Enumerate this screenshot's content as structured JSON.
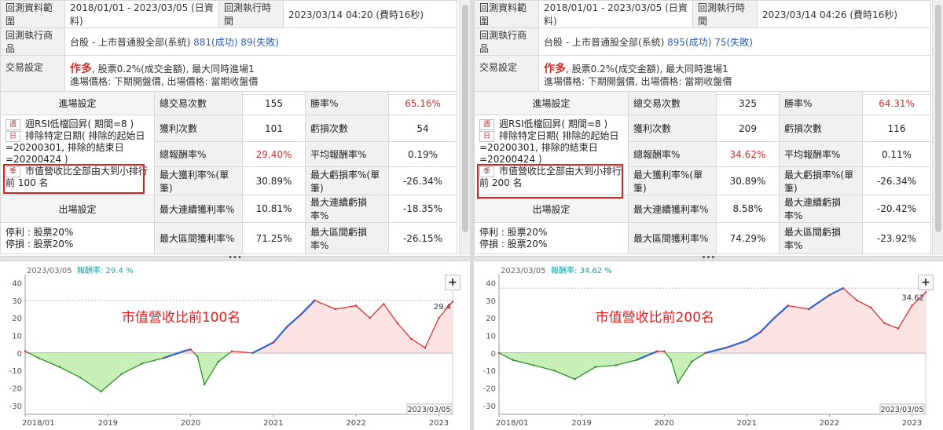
{
  "panels": [
    {
      "header": {
        "range_label": "回測資料範圍",
        "range_value": "2018/01/01 - 2023/03/05 (日資料)",
        "exec_time_label": "回測執行時間",
        "exec_time_value": "2023/03/14 04:20 (費時16秒)",
        "product_label": "回測執行商品",
        "product_value": "台股 - 上市普通股全部(系統)",
        "success": "881(成功)",
        "fail": "89(失敗)",
        "trade_label": "交易設定",
        "trade_mode": "作多",
        "trade_desc": ", 股票0.2%(成交金額), 最大同時進場1",
        "trade_desc2": "進場價格: 下期開盤價, 出場價格: 當期收盤價"
      },
      "entry": {
        "title": "進場設定",
        "tag1": "週",
        "cond1": "週RSI低檔回昇( 期間=8 )",
        "tag2": "日",
        "cond2": "排除特定日期( 排除的起始日=20200301, 排除的結束日=20200424 )",
        "tag3": "季",
        "cond3": "市值營收比全部由大到小排行前 100 名"
      },
      "exit": {
        "title": "出場設定",
        "stop_profit": "停利 : 股票20%",
        "stop_loss": "停損 : 股票20%"
      },
      "stats": [
        {
          "l1": "總交易次數",
          "v1": "155",
          "l2": "勝率%",
          "v2": "65.16%"
        },
        {
          "l1": "獲利次數",
          "v1": "101",
          "l2": "虧損次數",
          "v2": "54"
        },
        {
          "l1": "總報酬率%",
          "v1": "29.40%",
          "l2": "平均報酬率%",
          "v2": "0.19%"
        },
        {
          "l1": "最大獲利率%(單筆)",
          "v1": "30.89%",
          "l2": "最大虧損率%(單筆)",
          "v2": "-26.34%"
        },
        {
          "l1": "最大連續獲利率%",
          "v1": "10.81%",
          "l2": "最大連續虧損率%",
          "v2": "-18.35%"
        },
        {
          "l1": "最大區間獲利率%",
          "v1": "71.25%",
          "l2": "最大區間虧損率%",
          "v2": "-26.15%"
        }
      ],
      "chart": {
        "date_label": "2023/03/05",
        "return_label": "報酬率: 29.4 %",
        "annotation": "市值營收比前100名",
        "last_value": "29.4",
        "end_date_label": "2023/03/05",
        "y_ticks": [
          "40",
          "30",
          "20",
          "10",
          "0",
          "-10",
          "-20",
          "-30"
        ],
        "x_ticks": [
          "2018/01",
          "2019",
          "2020",
          "2021",
          "2022",
          "2023"
        ]
      },
      "chart_data": {
        "type": "area",
        "x": [
          "2018/01",
          "2018/03",
          "2018/06",
          "2018/09",
          "2018/12",
          "2019/03",
          "2019/06",
          "2019/09",
          "2019/12",
          "2020/01",
          "2020/02",
          "2020/03",
          "2020/05",
          "2020/07",
          "2020/10",
          "2021/01",
          "2021/03",
          "2021/05",
          "2021/07",
          "2021/10",
          "2022/01",
          "2022/03",
          "2022/05",
          "2022/07",
          "2022/09",
          "2022/11",
          "2023/01",
          "2023/03"
        ],
        "y": [
          1,
          -3,
          -8,
          -14,
          -22,
          -12,
          -6,
          -3,
          1,
          2,
          -2,
          -18,
          -5,
          1,
          0,
          6,
          15,
          22,
          30,
          25,
          27,
          20,
          28,
          17,
          8,
          3,
          20,
          29.4
        ],
        "ylim": [
          -35,
          42
        ],
        "grid": false
      }
    },
    {
      "header": {
        "range_label": "回測資料範圍",
        "range_value": "2018/01/01 - 2023/03/05 (日資料)",
        "exec_time_label": "回測執行時間",
        "exec_time_value": "2023/03/14 04:26 (費時16秒)",
        "product_label": "回測執行商品",
        "product_value": "台股 - 上市普通股全部(系統)",
        "success": "895(成功)",
        "fail": "75(失敗)",
        "trade_label": "交易設定",
        "trade_mode": "作多",
        "trade_desc": ", 股票0.2%(成交金額), 最大同時進場1",
        "trade_desc2": "進場價格: 下期開盤價, 出場價格: 當期收盤價"
      },
      "entry": {
        "title": "進場設定",
        "tag1": "週",
        "cond1": "週RSI低檔回昇( 期間=8 )",
        "tag2": "日",
        "cond2": "排除特定日期( 排除的起始日=20200301, 排除的結束日=20200424 )",
        "tag3": "季",
        "cond3": "市值營收比全部由大到小排行前 200 名"
      },
      "exit": {
        "title": "出場設定",
        "stop_profit": "停利 : 股票20%",
        "stop_loss": "停損 : 股票20%"
      },
      "stats": [
        {
          "l1": "總交易次數",
          "v1": "325",
          "l2": "勝率%",
          "v2": "64.31%"
        },
        {
          "l1": "獲利次數",
          "v1": "209",
          "l2": "虧損次數",
          "v2": "116"
        },
        {
          "l1": "總報酬率%",
          "v1": "34.62%",
          "l2": "平均報酬率%",
          "v2": "0.11%"
        },
        {
          "l1": "最大獲利率%(單筆)",
          "v1": "30.89%",
          "l2": "最大虧損率%(單筆)",
          "v2": "-26.34%"
        },
        {
          "l1": "最大連續獲利率%",
          "v1": "8.58%",
          "l2": "最大連續虧損率%",
          "v2": "-20.42%"
        },
        {
          "l1": "最大區間獲利率%",
          "v1": "74.29%",
          "l2": "最大區間虧損率%",
          "v2": "-23.92%"
        }
      ],
      "chart": {
        "date_label": "2023/03/05",
        "return_label": "報酬率: 34.62 %",
        "annotation": "市值營收比前200名",
        "last_value": "34.62",
        "end_date_label": "2023/03/05",
        "y_ticks": [
          "40",
          "30",
          "20",
          "10",
          "0",
          "-10",
          "-20",
          "-30"
        ],
        "x_ticks": [
          "2018/01",
          "2019",
          "2020",
          "2021",
          "2022",
          "2023"
        ]
      },
      "chart_data": {
        "type": "area",
        "x": [
          "2018/01",
          "2018/03",
          "2018/06",
          "2018/09",
          "2018/12",
          "2019/03",
          "2019/06",
          "2019/09",
          "2019/12",
          "2020/01",
          "2020/02",
          "2020/03",
          "2020/05",
          "2020/07",
          "2020/10",
          "2021/01",
          "2021/03",
          "2021/05",
          "2021/07",
          "2021/10",
          "2022/01",
          "2022/03",
          "2022/05",
          "2022/07",
          "2022/09",
          "2022/11",
          "2023/01",
          "2023/03"
        ],
        "y": [
          0,
          -4,
          -7,
          -10,
          -15,
          -8,
          -7,
          -4,
          1,
          1,
          -4,
          -17,
          -5,
          0,
          3,
          7,
          12,
          20,
          27,
          25,
          33,
          37,
          30,
          26,
          17,
          14,
          27,
          34.62
        ],
        "ylim": [
          -35,
          42
        ],
        "grid": false
      }
    }
  ],
  "colors": {
    "gain_line": "#e02424",
    "loss_line": "#1f8a1f",
    "gain_fill": "#fbe3e3",
    "loss_fill": "#c9efb9",
    "new_high": "#2a62d8",
    "highlight_box": "#e02020"
  },
  "icons": {
    "add": "plus-icon",
    "splitter": "drag-handle-icon"
  },
  "ui": {
    "plus": "+",
    "dots": "•••"
  }
}
